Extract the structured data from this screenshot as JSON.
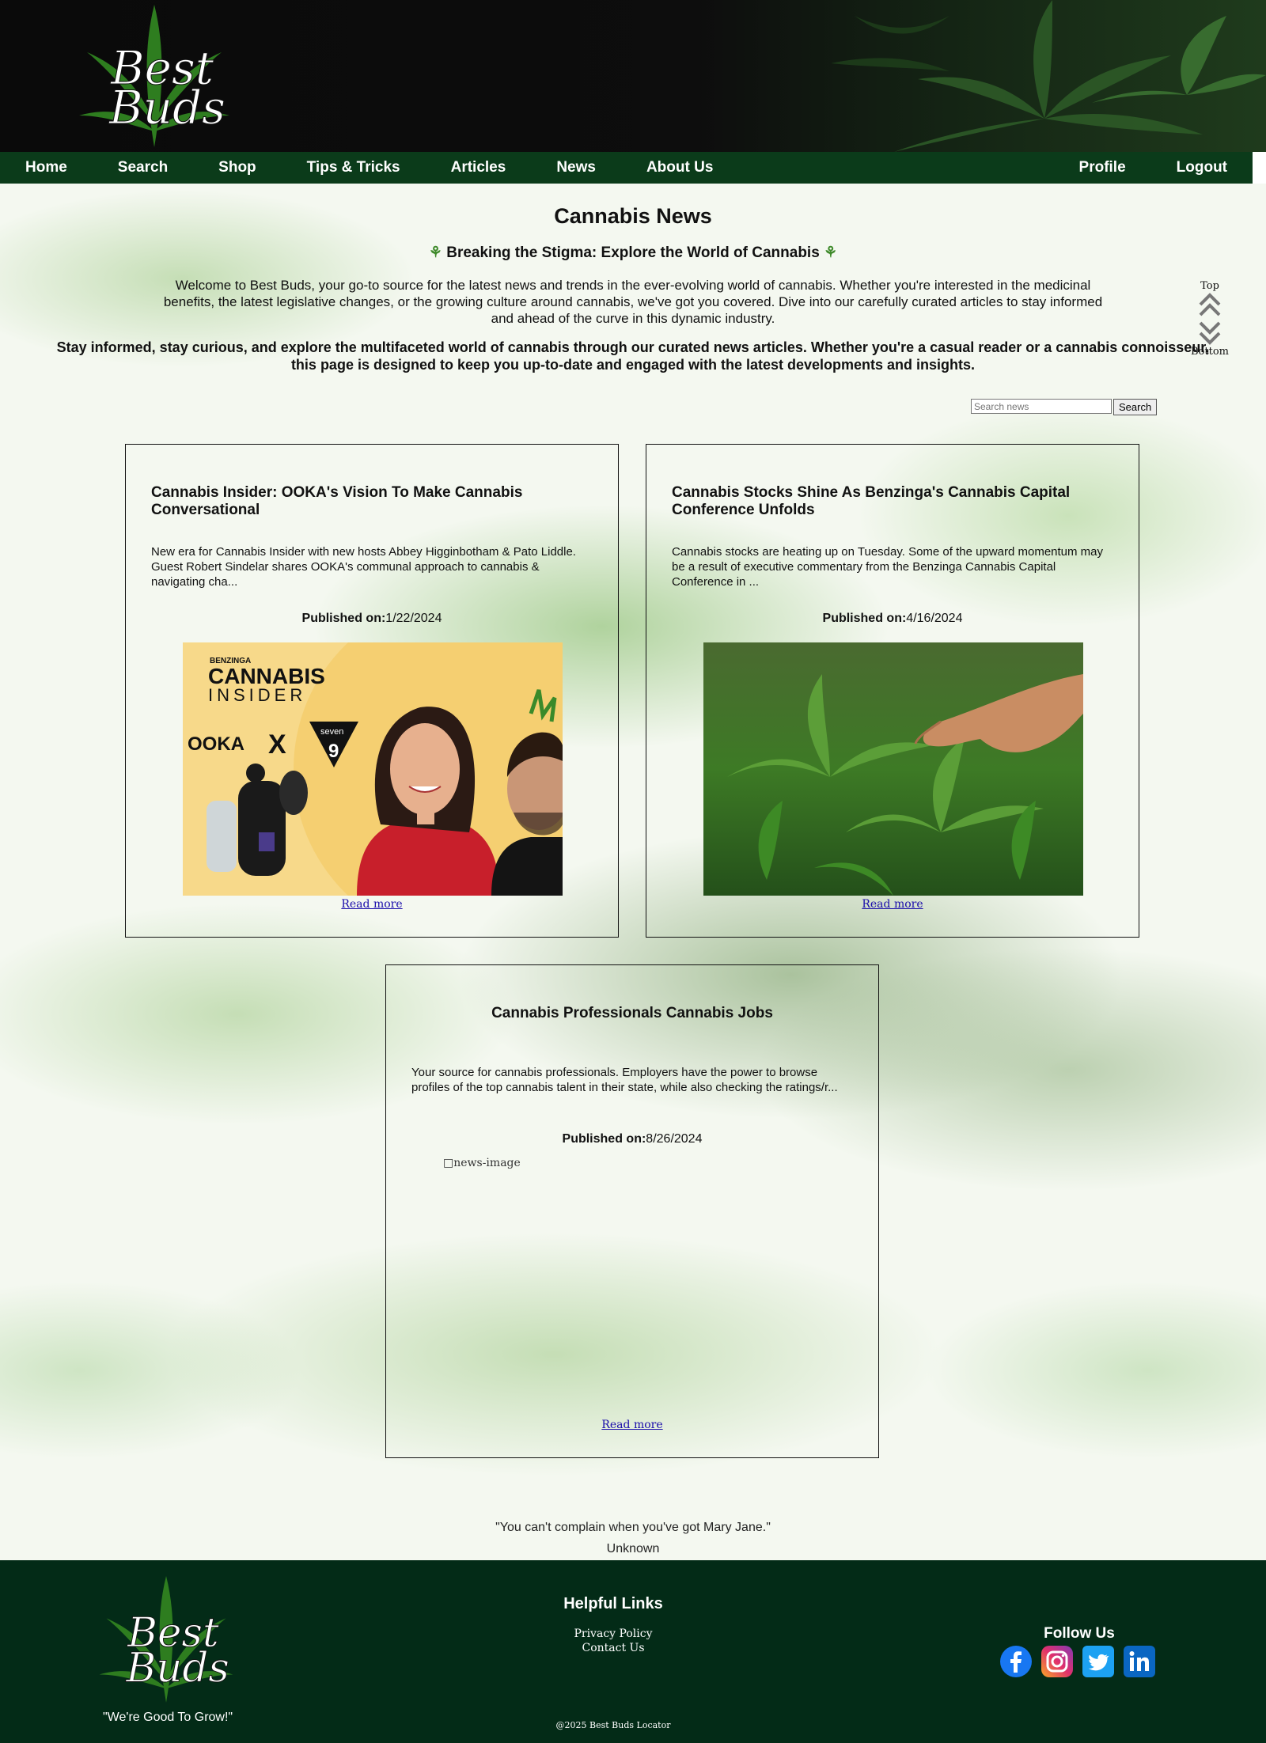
{
  "brand": {
    "logo_top_word": "Best",
    "logo_bottom_word": "Buds",
    "tagline": "\"We're Good To Grow!\""
  },
  "nav": {
    "left": [
      "Home",
      "Search",
      "Shop",
      "Tips & Tricks",
      "Articles",
      "News",
      "About Us"
    ],
    "right": [
      "Profile",
      "Logout"
    ]
  },
  "page": {
    "title": "Cannabis News",
    "subtitle": "Breaking the Stigma: Explore the World of Cannabis",
    "subtitle_icon": "leaf-emoji",
    "intro": "Welcome to Best Buds, your go-to source for the latest news and trends in the ever-evolving world of cannabis. Whether you're interested in the medicinal benefits, the latest legislative changes, or the growing culture around cannabis, we've got you covered. Dive into our carefully curated articles to stay informed and ahead of the curve in this dynamic industry.",
    "intro_bold": "Stay informed, stay curious, and explore the multifaceted world of cannabis through our curated news articles. Whether you're a casual reader or a cannabis connoisseur, this page is designed to keep you up-to-date and engaged with the latest developments and insights."
  },
  "scroll_nav": {
    "top_label": "Top",
    "bottom_label": "Bottom"
  },
  "search": {
    "placeholder": "Search news",
    "button": "Search"
  },
  "published_label": "Published on:",
  "read_more": "Read more",
  "articles": [
    {
      "title": "Cannabis Insider: OOKA's Vision To Make Cannabis Conversational",
      "description": "New era for Cannabis Insider with new hosts Abbey Higginbotham & Pato Liddle. Guest Robert Sindelar shares OOKA's communal approach to cannabis & navigating cha...",
      "date": "1/22/2024",
      "image_kind": "promo",
      "image_text": {
        "brand": "BENZINGA",
        "title": "CANNABIS",
        "sub": "INSIDER",
        "partner": "OOKA",
        "cross": "X",
        "badge_top": "seven",
        "badge_num": "9"
      }
    },
    {
      "title": "Cannabis Stocks Shine As Benzinga's Cannabis Capital Conference Unfolds",
      "description": "Cannabis stocks are heating up on Tuesday. Some of the upward momentum may be a result of executive commentary from the Benzinga Cannabis Capital Conference in ...",
      "date": "4/16/2024",
      "image_kind": "plant"
    },
    {
      "title": "Cannabis Professionals Cannabis Jobs",
      "description": "Your source for cannabis professionals. Employers have the power to browse profiles of the top cannabis talent in their state, while also checking the ratings/r...",
      "date": "8/26/2024",
      "image_kind": "broken",
      "image_alt": "news-image"
    }
  ],
  "quote": {
    "text": "\"You can't complain when you've got Mary Jane.\"",
    "author": "Unknown"
  },
  "footer": {
    "helpful_title": "Helpful Links",
    "links": [
      "Privacy Policy",
      "Contact Us"
    ],
    "copyright": "@2025 Best Buds Locator",
    "follow_title": "Follow Us",
    "social": [
      "facebook-icon",
      "instagram-icon",
      "twitter-icon",
      "linkedin-icon"
    ]
  },
  "colors": {
    "nav_bg": "#0b3b1a",
    "footer_bg": "#032b17",
    "link": "#1a0dab",
    "leaf_green": "#3e8a2a"
  }
}
